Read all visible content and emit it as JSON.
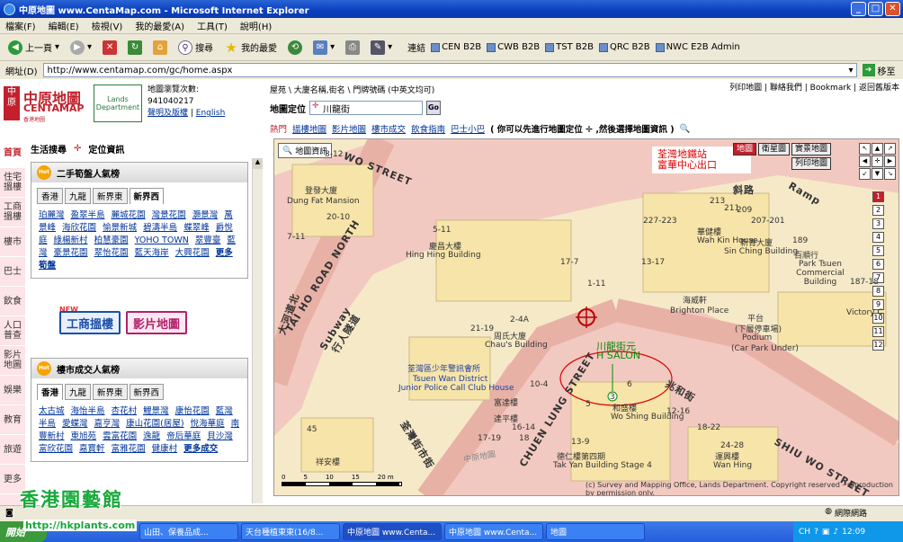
{
  "window": {
    "title": "中原地圖 www.CentaMap.com - Microsoft Internet Explorer"
  },
  "menu": [
    "檔案(F)",
    "編輯(E)",
    "檢視(V)",
    "我的最愛(A)",
    "工具(T)",
    "說明(H)"
  ],
  "toolbar": {
    "back": "上一頁",
    "search": "搜尋",
    "favorites": "我的最愛",
    "links_label": "連結",
    "links": [
      "CEN B2B",
      "CWB B2B",
      "TST B2B",
      "QRC B2B",
      "NWC E2B Admin"
    ]
  },
  "address": {
    "label": "網址(D)",
    "url": "http://www.centamap.com/gc/home.aspx",
    "go": "移至"
  },
  "site": {
    "logo_cn": "中原地圖",
    "logo_en": "CENTAMAP",
    "logo_sub": "香港地圖",
    "logo_sq": "中原",
    "lands": "Lands Department",
    "counter_label": "地圖瀏覽次數:",
    "counter": "941040217",
    "disclaimer": "聲明及版權",
    "english": "English",
    "toplinks": "列印地圖 | 聯絡我們 | Bookmark | 返回舊版本",
    "crumb": "屋苑 \\ 大廈名稱,街名 \\ 門牌號碼 (中英文均可)",
    "search_label": "地圖定位",
    "search_value": "川龍街",
    "go_btn": "Go",
    "funcs": [
      "熱門",
      "搵樓地圖",
      "影片地圖",
      "樓市成交",
      "飲食指南",
      "巴士小巴"
    ],
    "hint": "( 你可以先進行地圖定位 ✛ ,然後選擇地圖資訊 )"
  },
  "sidenav": [
    "首頁",
    "住宅搵樓",
    "工商搵樓",
    "樓市",
    "巴士",
    "飲食",
    "人口普查",
    "影片地圖",
    "娛樂",
    "教育",
    "旅遊",
    "更多"
  ],
  "left": {
    "hd1": "生活搜尋",
    "hd2": "定位資訊",
    "p1_title": "二手筍盤人氣榜",
    "tabs1": [
      "香港",
      "九龍",
      "新界東",
      "新界西"
    ],
    "p1_items": [
      "珀麗灣",
      "盈翠半島",
      "麗城花園",
      "灣景花園",
      "灝景灣",
      "萬景峰",
      "海欣花園",
      "愉景新城",
      "碧濤半島",
      "蝶翠峰",
      "爵悅庭",
      "綠楊新村",
      "柏慧豪園",
      "YOHO TOWN",
      "翠豐臺",
      "藍灣",
      "豪景花園",
      "翠怡花園",
      "藍天海岸",
      "大興花園"
    ],
    "p1_more": "更多筍盤",
    "new": "NEW",
    "btn1": "工商搵樓",
    "btn2": "影片地圖",
    "p2_title": "樓市成交人氣榜",
    "tabs2": [
      "香港",
      "九龍",
      "新界東",
      "新界西"
    ],
    "p2_items": [
      "太古城",
      "海怡半島",
      "杏花村",
      "鯉景灣",
      "康怡花園",
      "藍灣半島",
      "愛蝶灣",
      "嘉亨灣",
      "康山花園(居屋)",
      "悅海華庭",
      "南豐新村",
      "東旭苑",
      "雲富花園",
      "逸龍",
      "帝后華庭",
      "貝沙灣",
      "富欣花園",
      "嘉寶軒",
      "富雅花園",
      "健康村"
    ],
    "p2_more": "更多成交"
  },
  "map": {
    "search_btn": "地圖資訊",
    "btns_row1": [
      "地圖",
      "衛星圖",
      "實景地圖"
    ],
    "btn_print": "列印地圖",
    "zoom": [
      "1",
      "2",
      "3",
      "4",
      "5",
      "6",
      "7",
      "8",
      "9",
      "10",
      "11",
      "12"
    ],
    "streets": [
      "TAI HO ROAD NORTH",
      "CHUEN LUNG STREET",
      "SHIU WO STREET",
      "WO STREET",
      "兆和街",
      "斜路",
      "Ramp",
      "行人隧道",
      "Subway",
      "荃灣街市街",
      "中原地圖",
      "大河道北"
    ],
    "buildings": [
      "登發大廈",
      "Dung Fat Mansion",
      "慶昌大樓",
      "Hing Hing Building",
      "華健樓",
      "Wah Kin House",
      "新青大廈",
      "Sin Ching Building",
      "百順行",
      "Park Tsuen Commercial Building",
      "海威軒",
      "Brighton Place",
      "平台",
      "(下層停車場)",
      "Podium",
      "(Car Park Under)",
      "周氏大廈",
      "Chau's Building",
      "荃灣區少年警訊會所",
      "Tsuen Wan District",
      "Junior Police Call Club House",
      "富達樓",
      "達平樓",
      "和盛樓",
      "Wo Shing Building",
      "德仁樓第四期",
      "Tak Yan Building Stage 4",
      "運興樓",
      "Wan Hing",
      "祥安樓",
      "Victory C"
    ],
    "numbers": [
      "8-12",
      "20-10",
      "7-11",
      "5-11",
      "227-223",
      "17-7",
      "13-17",
      "1-11",
      "213",
      "211",
      "209",
      "207-201",
      "189",
      "187-18",
      "2-4A",
      "21-19",
      "10-4",
      "16-14",
      "17-19",
      "18",
      "45",
      "13-9",
      "3",
      "6",
      "5",
      "12-16",
      "18-22",
      "24-28"
    ],
    "annot_station1": "荃灣地鐵站",
    "annot_station2": "富華中心出口",
    "annot_salon1": "川龍街元",
    "annot_salon2": "H SALON",
    "scale": [
      "0",
      "5",
      "10",
      "15",
      "20 m"
    ],
    "copyright": "(c) Survey and Mapping Office, Lands Department. Copyright reserved - reproduction by permission only."
  },
  "status": {
    "zone": "網際網路"
  },
  "taskbar": {
    "start": "開始",
    "tasks": [
      "山田、保養品成...",
      "天台種植東東(16/8...",
      "中原地圖 www.Centa...",
      "中原地圖 www.Centa...",
      "地圖"
    ],
    "lang": "CH",
    "time": "12:09"
  },
  "watermark": {
    "title": "香港園藝館",
    "url": "http://hkplants.com"
  }
}
